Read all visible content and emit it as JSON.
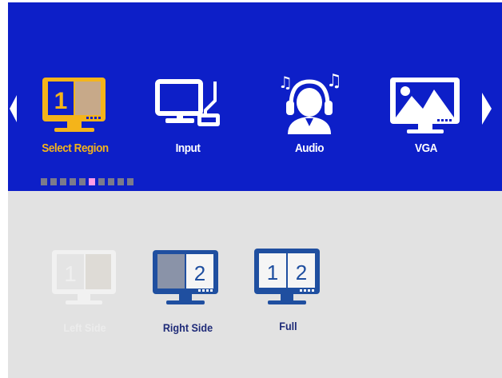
{
  "menu": {
    "items": [
      {
        "label": "Select Region",
        "icon": "select-region-icon",
        "selected": true
      },
      {
        "label": "Input",
        "icon": "input-icon"
      },
      {
        "label": "Audio",
        "icon": "audio-icon"
      },
      {
        "label": "VGA",
        "icon": "vga-icon"
      }
    ],
    "page_indicator": {
      "total": 10,
      "active_index": 5
    },
    "icon_number": "1"
  },
  "options": {
    "items": [
      {
        "label": "Left Side",
        "icon": "left-side-icon",
        "numbers": [
          "1"
        ]
      },
      {
        "label": "Right Side",
        "icon": "right-side-icon",
        "numbers": [
          "2"
        ]
      },
      {
        "label": "Full",
        "icon": "full-icon",
        "numbers": [
          "1",
          "2"
        ]
      }
    ]
  },
  "colors": {
    "osd_blue": "#0d1fc8",
    "selected_orange": "#f4b41a",
    "option_blue": "#1f4fa0",
    "panel_gray": "#e2e2e2"
  }
}
